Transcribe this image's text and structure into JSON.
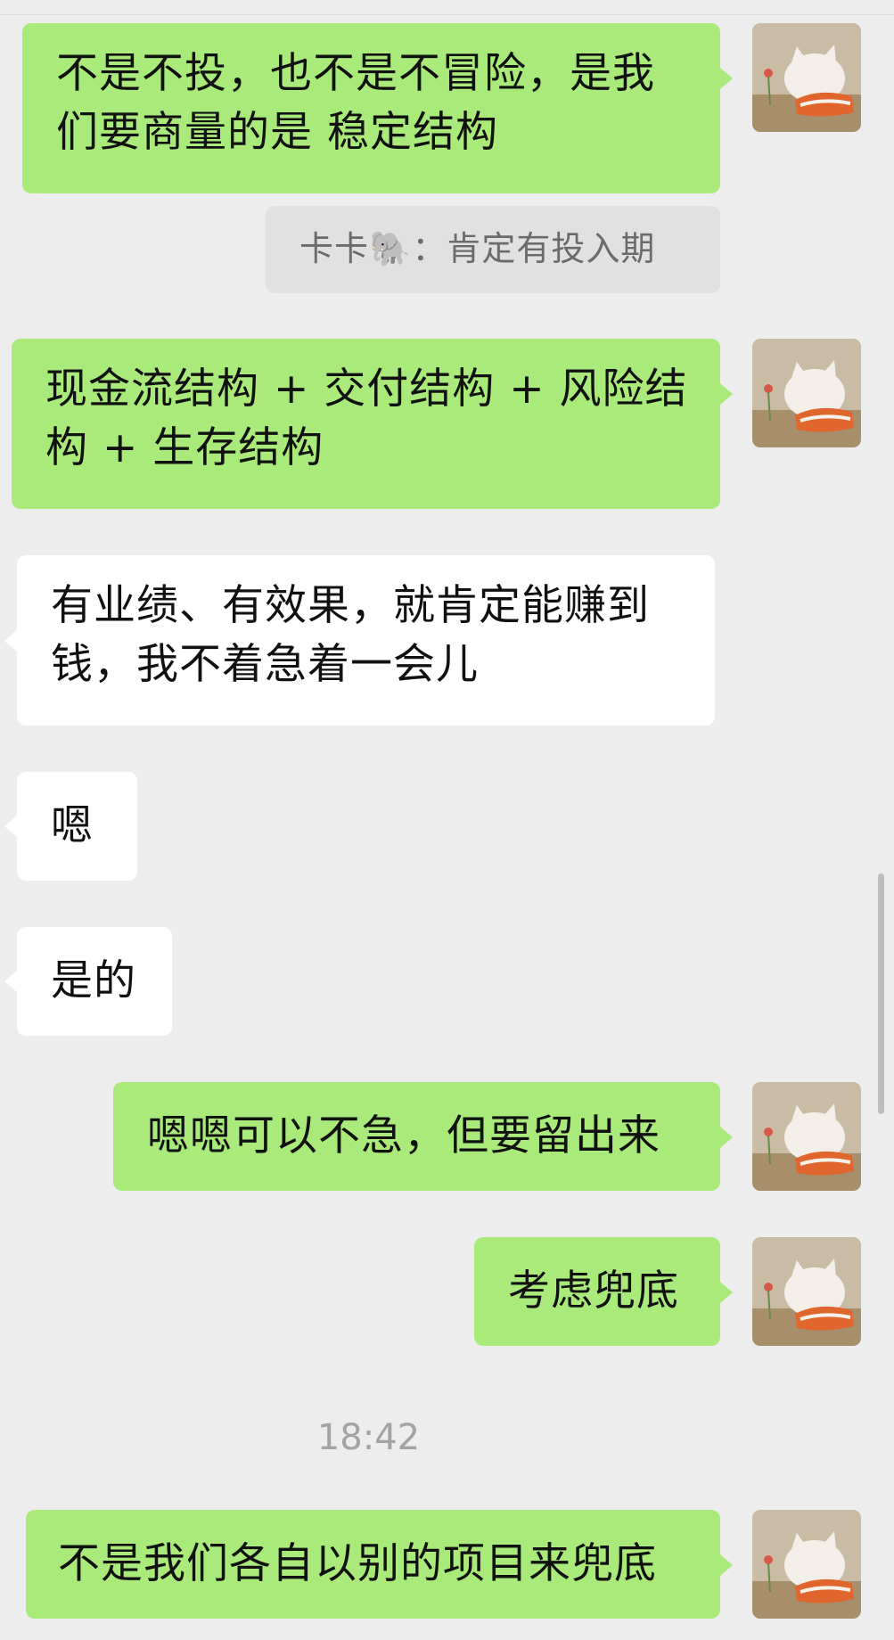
{
  "messages": [
    {
      "text": "不是不投，也不是不冒险，是我们要商量的是 稳定结构"
    },
    {
      "quote": "卡卡🐘：肯定有投入期"
    },
    {
      "text": "现金流结构 + 交付结构 + 风险结构 + 生存结构"
    },
    {
      "text": "有业绩、有效果，就肯定能赚到钱，我不着急着一会儿"
    },
    {
      "text": "嗯"
    },
    {
      "text": "是的"
    },
    {
      "text": "嗯嗯可以不急，但要留出来"
    },
    {
      "text": "考虑兜底"
    },
    {
      "text": "不是我们各自以别的项目来兜底"
    }
  ],
  "timestamp": "18:42",
  "icons": {
    "avatar": "cat-avatar-icon"
  },
  "colors": {
    "background": "#ededed",
    "outgoing_bubble": "#a9ea7a",
    "incoming_bubble": "#ffffff",
    "quote_background": "#e1e1e1"
  }
}
